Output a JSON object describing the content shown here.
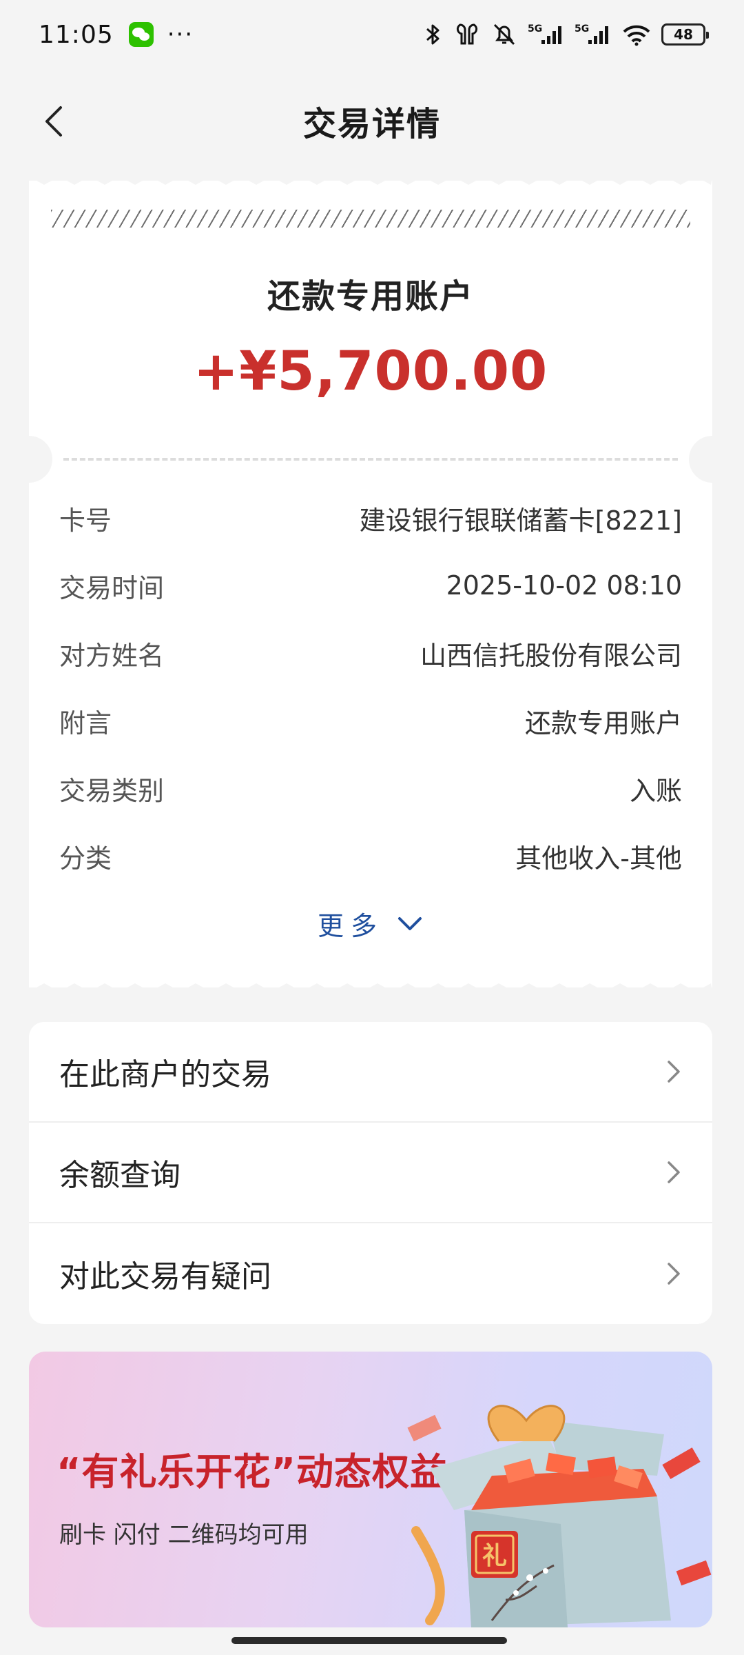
{
  "status_bar": {
    "time": "11:05",
    "dots": "···",
    "battery": "48",
    "network1": "5G",
    "network2": "5G"
  },
  "nav": {
    "title": "交易详情"
  },
  "receipt": {
    "account_name": "还款专用账户",
    "amount": "+¥5,700.00",
    "amount_color": "#c9302c",
    "details": [
      {
        "label": "卡号",
        "value": "建设银行银联储蓄卡[8221]"
      },
      {
        "label": "交易时间",
        "value": "2025-10-02 08:10"
      },
      {
        "label": "对方姓名",
        "value": "山西信托股份有限公司"
      },
      {
        "label": "附言",
        "value": "还款专用账户"
      },
      {
        "label": "交易类别",
        "value": "入账"
      },
      {
        "label": "分类",
        "value": "其他收入-其他"
      }
    ],
    "more_label": "更多"
  },
  "menu": {
    "items": [
      {
        "label": "在此商户的交易"
      },
      {
        "label": "余额查询"
      },
      {
        "label": "对此交易有疑问"
      }
    ]
  },
  "banner": {
    "title": "“有礼乐开花”动态权益",
    "subtitle": "刷卡 闪付 二维码均可用",
    "badge_char": "礼"
  }
}
